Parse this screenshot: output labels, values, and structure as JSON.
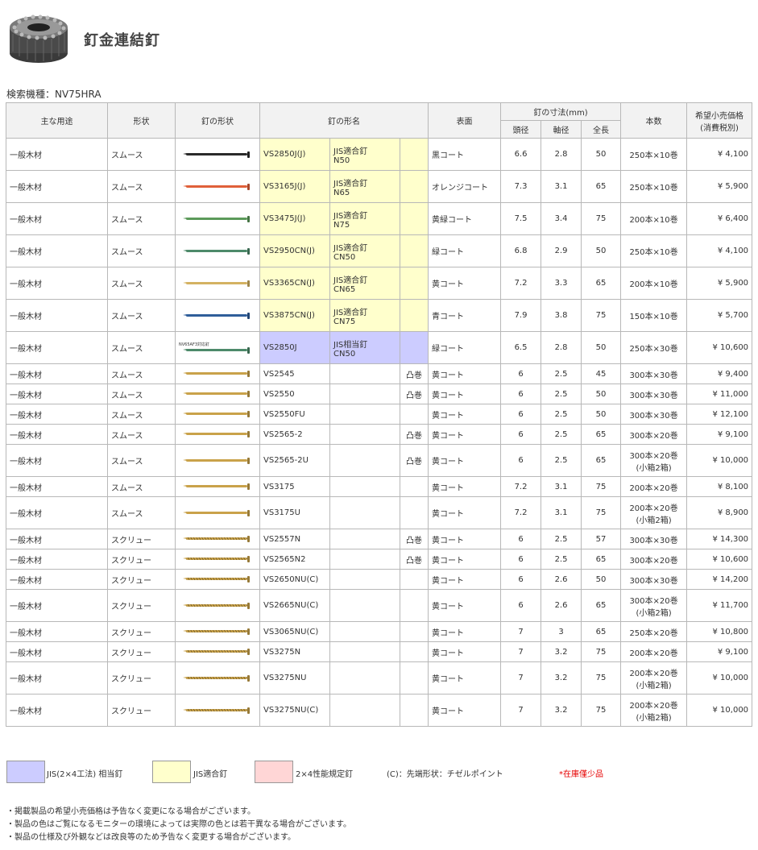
{
  "page": {
    "title": "釘金連結釘",
    "model_label": "検索機種：NV75HRA"
  },
  "headers": {
    "use": "主な用途",
    "shape": "形状",
    "nail_shape": "釘の形状",
    "name": "釘の形名",
    "surface": "表面",
    "dims": "釘の寸法(mm)",
    "head": "頭径",
    "shaft": "軸径",
    "length": "全長",
    "qty": "本数",
    "price_line1": "希望小売価格",
    "price_line2": "(消費税別)"
  },
  "rows": [
    {
      "use": "一般木材",
      "shape": "スムース",
      "nail_color": "#2a2a2a",
      "nail_type": "smooth",
      "code": "VS2850J(J)",
      "std1": "JIS適合釘",
      "std2": "N50",
      "cls": "jis",
      "coil": "",
      "surface": "黒コート",
      "head": "6.6",
      "shaft": "2.8",
      "length": "50",
      "qty1": "250本×10巻",
      "qty2": "",
      "price": "¥ 4,100"
    },
    {
      "use": "一般木材",
      "shape": "スムース",
      "nail_color": "#e0603a",
      "nail_type": "smooth",
      "code": "VS3165J(J)",
      "std1": "JIS適合釘",
      "std2": "N65",
      "cls": "jis",
      "coil": "",
      "surface": "オレンジコート",
      "head": "7.3",
      "shaft": "3.1",
      "length": "65",
      "qty1": "250本×10巻",
      "qty2": "",
      "price": "¥ 5,900"
    },
    {
      "use": "一般木材",
      "shape": "スムース",
      "nail_color": "#5c9a5a",
      "nail_type": "smooth",
      "code": "VS3475J(J)",
      "std1": "JIS適合釘",
      "std2": "N75",
      "cls": "jis",
      "coil": "",
      "surface": "黄緑コート",
      "head": "7.5",
      "shaft": "3.4",
      "length": "75",
      "qty1": "200本×10巻",
      "qty2": "",
      "price": "¥ 6,400"
    },
    {
      "use": "一般木材",
      "shape": "スムース",
      "nail_color": "#4d8a6a",
      "nail_type": "smooth",
      "code": "VS2950CN(J)",
      "std1": "JIS適合釘",
      "std2": "CN50",
      "cls": "jis",
      "coil": "",
      "surface": "緑コート",
      "head": "6.8",
      "shaft": "2.9",
      "length": "50",
      "qty1": "250本×10巻",
      "qty2": "",
      "price": "¥ 4,100"
    },
    {
      "use": "一般木材",
      "shape": "スムース",
      "nail_color": "#d4b262",
      "nail_type": "smooth",
      "code": "VS3365CN(J)",
      "std1": "JIS適合釘",
      "std2": "CN65",
      "cls": "jis",
      "coil": "",
      "surface": "黄コート",
      "head": "7.2",
      "shaft": "3.3",
      "length": "65",
      "qty1": "200本×10巻",
      "qty2": "",
      "price": "¥ 5,900"
    },
    {
      "use": "一般木材",
      "shape": "スムース",
      "nail_color": "#2f5e9a",
      "nail_type": "smooth",
      "code": "VS3875CN(J)",
      "std1": "JIS適合釘",
      "std2": "CN75",
      "cls": "jis",
      "coil": "",
      "surface": "青コート",
      "head": "7.9",
      "shaft": "3.8",
      "length": "75",
      "qty1": "150本×10巻",
      "qty2": "",
      "price": "¥ 5,700"
    },
    {
      "use": "一般木材",
      "shape": "スムース",
      "nail_color": "#4d8a6a",
      "nail_type": "smooth",
      "nail_note": "NV65AF3対応釘",
      "code": "VS2850J",
      "std1": "JIS相当釘",
      "std2": "CN50",
      "cls": "x4",
      "coil": "",
      "surface": "緑コート",
      "head": "6.5",
      "shaft": "2.8",
      "length": "50",
      "qty1": "250本×30巻",
      "qty2": "",
      "price": "¥ 10,600"
    },
    {
      "use": "一般木材",
      "shape": "スムース",
      "nail_color": "#c9a24a",
      "nail_type": "smooth",
      "code": "VS2545",
      "std1": "",
      "std2": "",
      "cls": "",
      "coil": "凸巻",
      "surface": "黄コート",
      "head": "6",
      "shaft": "2.5",
      "length": "45",
      "qty1": "300本×30巻",
      "qty2": "",
      "price": "¥ 9,400"
    },
    {
      "use": "一般木材",
      "shape": "スムース",
      "nail_color": "#c9a24a",
      "nail_type": "smooth",
      "code": "VS2550",
      "std1": "",
      "std2": "",
      "cls": "",
      "coil": "凸巻",
      "surface": "黄コート",
      "head": "6",
      "shaft": "2.5",
      "length": "50",
      "qty1": "300本×30巻",
      "qty2": "",
      "price": "¥ 11,000"
    },
    {
      "use": "一般木材",
      "shape": "スムース",
      "nail_color": "#c9a24a",
      "nail_type": "smooth",
      "code": "VS2550FU",
      "std1": "",
      "std2": "",
      "cls": "",
      "coil": "",
      "surface": "黄コート",
      "head": "6",
      "shaft": "2.5",
      "length": "50",
      "qty1": "300本×30巻",
      "qty2": "",
      "price": "¥ 12,100"
    },
    {
      "use": "一般木材",
      "shape": "スムース",
      "nail_color": "#c9a24a",
      "nail_type": "smooth",
      "code": "VS2565-2",
      "std1": "",
      "std2": "",
      "cls": "",
      "coil": "凸巻",
      "surface": "黄コート",
      "head": "6",
      "shaft": "2.5",
      "length": "65",
      "qty1": "300本×20巻",
      "qty2": "",
      "price": "¥ 9,100"
    },
    {
      "use": "一般木材",
      "shape": "スムース",
      "nail_color": "#c9a24a",
      "nail_type": "smooth",
      "code": "VS2565-2U",
      "std1": "",
      "std2": "",
      "cls": "",
      "coil": "凸巻",
      "surface": "黄コート",
      "head": "6",
      "shaft": "2.5",
      "length": "65",
      "qty1": "300本×20巻",
      "qty2": "(小箱2箱)",
      "price": "¥ 10,000"
    },
    {
      "use": "一般木材",
      "shape": "スムース",
      "nail_color": "#c9a24a",
      "nail_type": "smooth",
      "code": "VS3175",
      "std1": "",
      "std2": "",
      "cls": "",
      "coil": "",
      "surface": "黄コート",
      "head": "7.2",
      "shaft": "3.1",
      "length": "75",
      "qty1": "200本×20巻",
      "qty2": "",
      "price": "¥ 8,100"
    },
    {
      "use": "一般木材",
      "shape": "スムース",
      "nail_color": "#c9a24a",
      "nail_type": "smooth",
      "code": "VS3175U",
      "std1": "",
      "std2": "",
      "cls": "",
      "coil": "",
      "surface": "黄コート",
      "head": "7.2",
      "shaft": "3.1",
      "length": "75",
      "qty1": "200本×20巻",
      "qty2": "(小箱2箱)",
      "price": "¥ 8,900"
    },
    {
      "use": "一般木材",
      "shape": "スクリュー",
      "nail_color": "#c9a24a",
      "nail_type": "screw",
      "code": "VS2557N",
      "std1": "",
      "std2": "",
      "cls": "",
      "coil": "凸巻",
      "surface": "黄コート",
      "head": "6",
      "shaft": "2.5",
      "length": "57",
      "qty1": "300本×30巻",
      "qty2": "",
      "price": "¥ 14,300"
    },
    {
      "use": "一般木材",
      "shape": "スクリュー",
      "nail_color": "#c9a24a",
      "nail_type": "screw",
      "code": "VS2565N2",
      "std1": "",
      "std2": "",
      "cls": "",
      "coil": "凸巻",
      "surface": "黄コート",
      "head": "6",
      "shaft": "2.5",
      "length": "65",
      "qty1": "300本×20巻",
      "qty2": "",
      "price": "¥ 10,600"
    },
    {
      "use": "一般木材",
      "shape": "スクリュー",
      "nail_color": "#c9a24a",
      "nail_type": "screw",
      "code": "VS2650NU(C)",
      "std1": "",
      "std2": "",
      "cls": "",
      "coil": "",
      "surface": "黄コート",
      "head": "6",
      "shaft": "2.6",
      "length": "50",
      "qty1": "300本×30巻",
      "qty2": "",
      "price": "¥ 14,200"
    },
    {
      "use": "一般木材",
      "shape": "スクリュー",
      "nail_color": "#c9a24a",
      "nail_type": "screw",
      "code": "VS2665NU(C)",
      "std1": "",
      "std2": "",
      "cls": "",
      "coil": "",
      "surface": "黄コート",
      "head": "6",
      "shaft": "2.6",
      "length": "65",
      "qty1": "300本×20巻",
      "qty2": "(小箱2箱)",
      "price": "¥ 11,700"
    },
    {
      "use": "一般木材",
      "shape": "スクリュー",
      "nail_color": "#c9a24a",
      "nail_type": "screw",
      "code": "VS3065NU(C)",
      "std1": "",
      "std2": "",
      "cls": "",
      "coil": "",
      "surface": "黄コート",
      "head": "7",
      "shaft": "3",
      "length": "65",
      "qty1": "250本×20巻",
      "qty2": "",
      "price": "¥ 10,800"
    },
    {
      "use": "一般木材",
      "shape": "スクリュー",
      "nail_color": "#c9a24a",
      "nail_type": "screw",
      "code": "VS3275N",
      "std1": "",
      "std2": "",
      "cls": "",
      "coil": "",
      "surface": "黄コート",
      "head": "7",
      "shaft": "3.2",
      "length": "75",
      "qty1": "200本×20巻",
      "qty2": "",
      "price": "¥ 9,100"
    },
    {
      "use": "一般木材",
      "shape": "スクリュー",
      "nail_color": "#c9a24a",
      "nail_type": "screw",
      "code": "VS3275NU",
      "std1": "",
      "std2": "",
      "cls": "",
      "coil": "",
      "surface": "黄コート",
      "head": "7",
      "shaft": "3.2",
      "length": "75",
      "qty1": "200本×20巻",
      "qty2": "(小箱2箱)",
      "price": "¥ 10,000"
    },
    {
      "use": "一般木材",
      "shape": "スクリュー",
      "nail_color": "#c9a24a",
      "nail_type": "screw",
      "code": "VS3275NU(C)",
      "std1": "",
      "std2": "",
      "cls": "",
      "coil": "",
      "surface": "黄コート",
      "head": "7",
      "shaft": "3.2",
      "length": "75",
      "qty1": "200本×20巻",
      "qty2": "(小箱2箱)",
      "price": "¥ 10,000"
    }
  ],
  "legend": {
    "x4_color": "#ccccff",
    "x4_label": "JIS(2×4工法) 相当釘",
    "jis_color": "#ffffcc",
    "jis_label": "JIS適合釘",
    "perf_color": "#ffd6d6",
    "perf_label": "2×4性能規定釘",
    "tip_label": "(C)：先端形状：チゼルポイント",
    "stock_label": "*在庫僅少品"
  },
  "notes": [
    "・掲載製品の希望小売価格は予告なく変更になる場合がございます。",
    "・製品の色はご覧になるモニターの環境によっては実際の色とは若干異なる場合がございます。",
    "・製品の仕様及び外観などは改良等のため予告なく変更する場合がございます。"
  ]
}
